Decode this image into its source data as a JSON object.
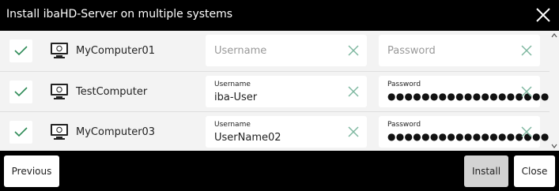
{
  "dialog": {
    "title": "Install ibaHD-Server on multiple systems",
    "close_icon": "close-icon"
  },
  "systems": [
    {
      "checked": true,
      "name": "MyComputer01",
      "username_placeholder": "Username",
      "password_placeholder": "Password",
      "username_label": "",
      "username_value": "",
      "password_label": "",
      "password_value": ""
    },
    {
      "checked": true,
      "name": "TestComputer",
      "username_label": "Username",
      "username_value": "iba-User",
      "password_label": "Password",
      "password_value": "●●●●●●●●●●●●●●●●●●●"
    },
    {
      "checked": true,
      "name": "MyComputer03",
      "username_label": "Username",
      "username_value": "UserName02",
      "password_label": "Password",
      "password_value": "●●●●●●●●●●●●●●●●●●●"
    }
  ],
  "footer": {
    "previous_label": "Previous",
    "install_label": "Install",
    "close_label": "Close"
  },
  "colors": {
    "accent": "#2e8b57",
    "clear_icon": "#7fb8a0"
  }
}
